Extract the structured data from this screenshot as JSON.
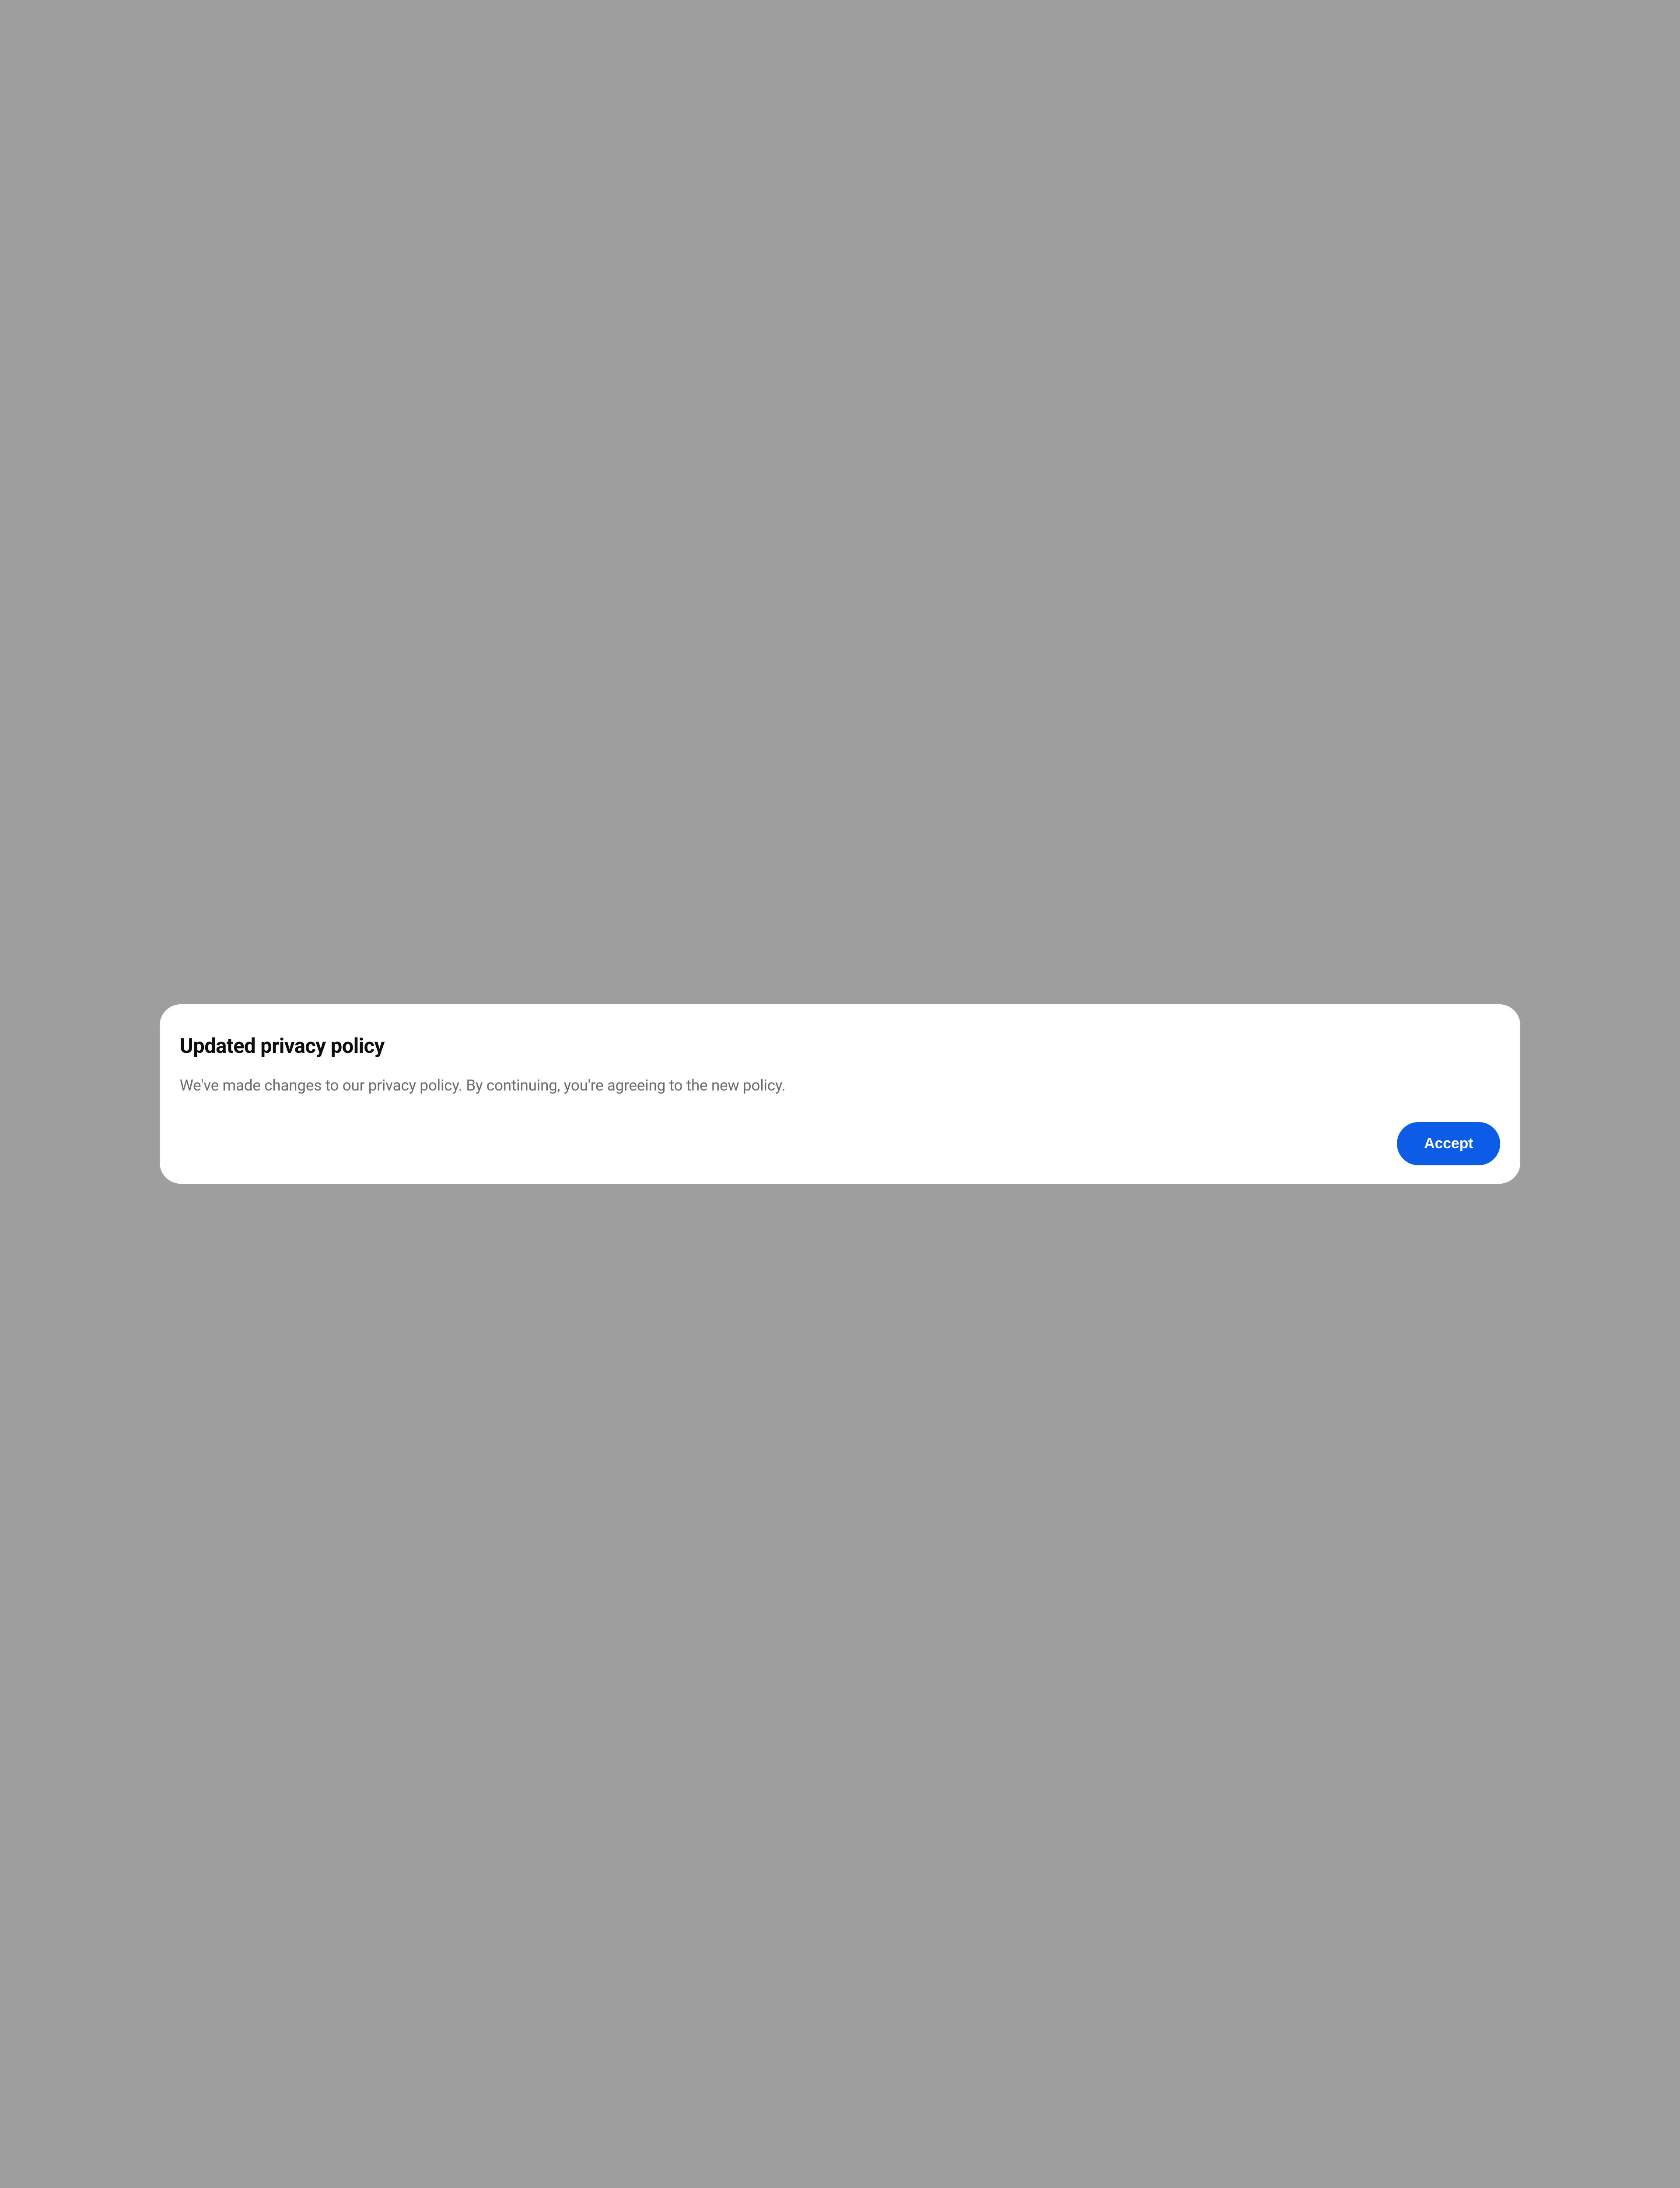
{
  "dialog": {
    "title": "Updated privacy policy",
    "body": "We've made changes to our privacy policy. By continuing, you're agreeing to the new policy.",
    "accept_label": "Accept"
  },
  "colors": {
    "background": "#9e9e9e",
    "card_bg": "#ffffff",
    "title_text": "#0d0d0d",
    "body_text": "#6b6b6b",
    "button_bg": "#0d5ce6",
    "button_text": "#ffffff"
  }
}
